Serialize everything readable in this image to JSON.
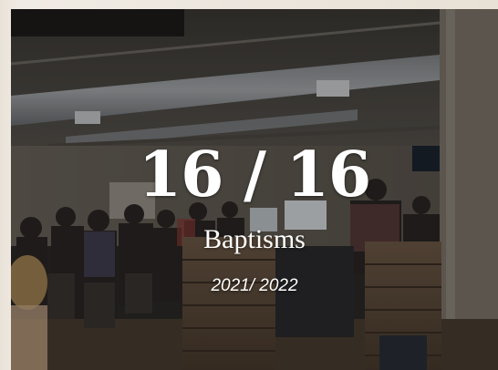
{
  "stat": {
    "number": "16 / 16",
    "label": "Baptisms",
    "years": "2021/ 2022"
  }
}
